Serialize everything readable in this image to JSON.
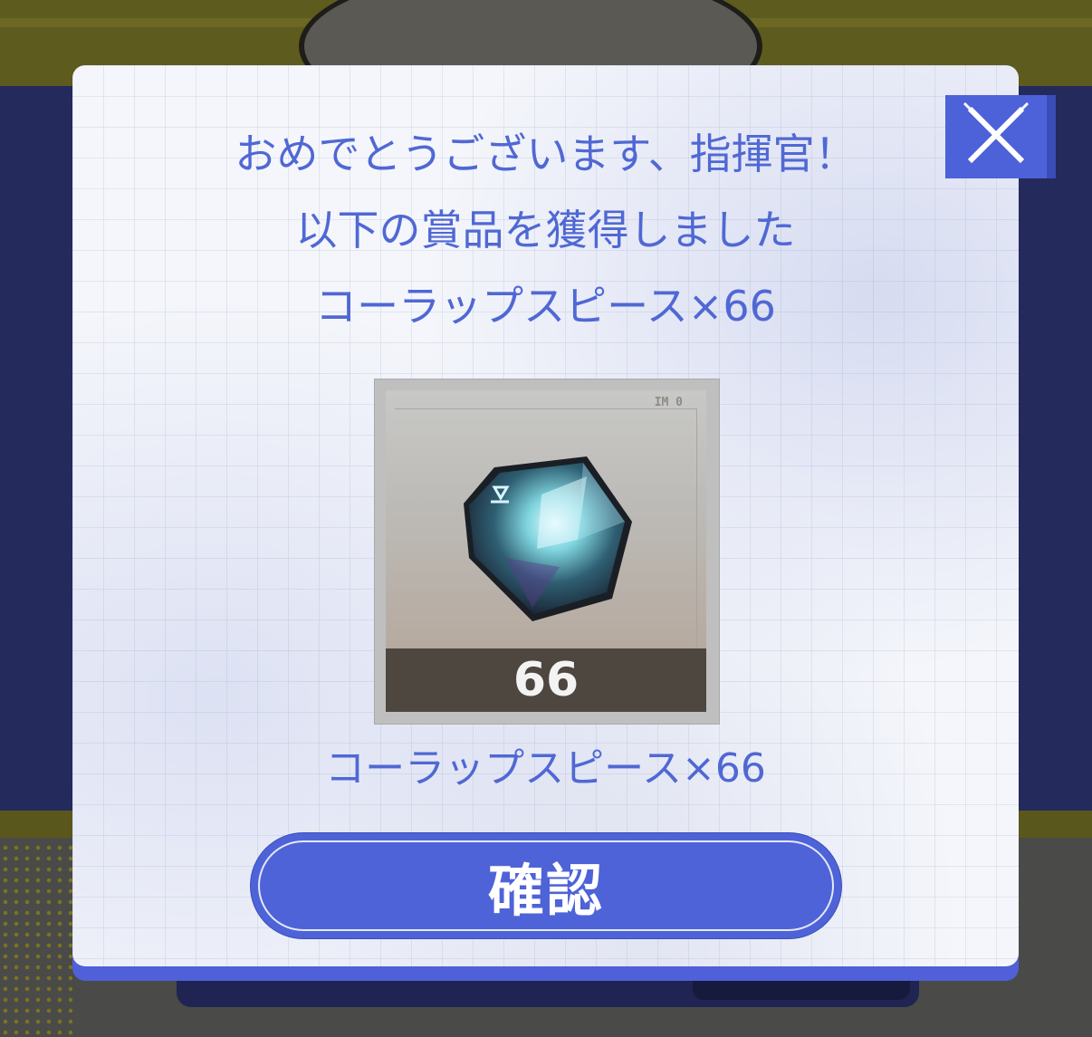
{
  "dialog": {
    "headline_lines": [
      "おめでとうございます、指揮官！",
      "以下の賞品を獲得しました",
      "コーラップスピース×66"
    ],
    "close_icon": "close-icon",
    "reward": {
      "icon": "crystal-icon",
      "frame_tag": "IM 0",
      "count": "66",
      "name": "コーラップスピース×66"
    },
    "confirm_label": "確認"
  },
  "colors": {
    "accent": "#4e63d8",
    "text": "#5068d4"
  }
}
